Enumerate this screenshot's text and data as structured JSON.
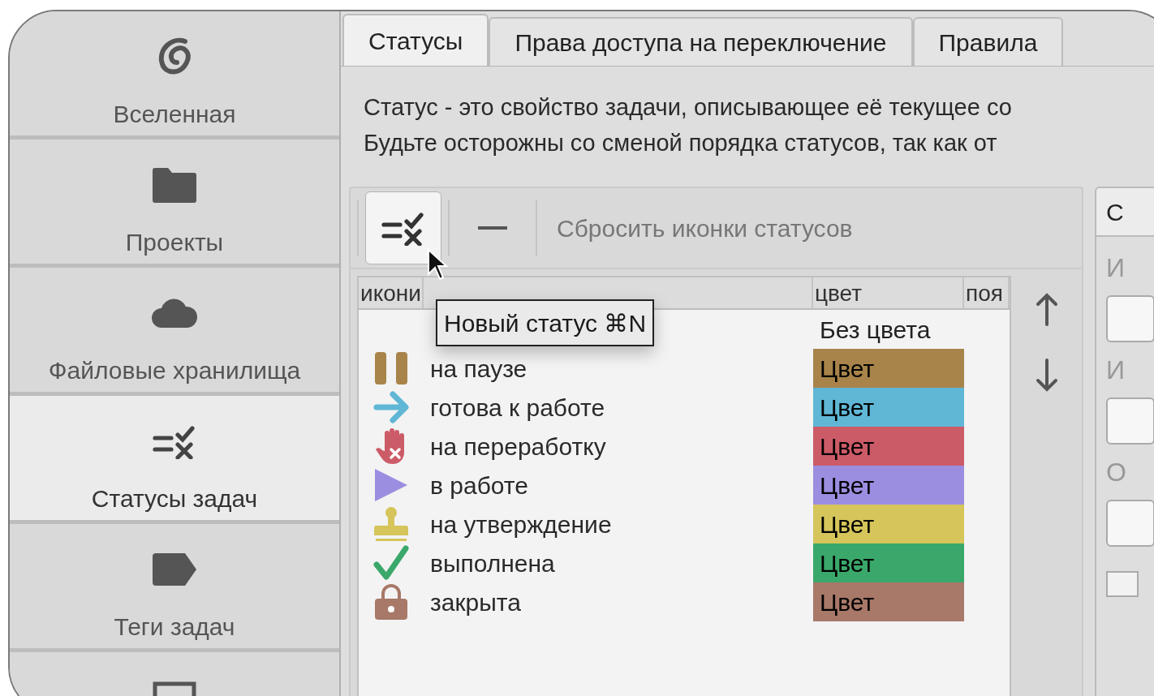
{
  "sidebar": {
    "items": [
      {
        "label": "Вселенная",
        "kind": "swirl",
        "selected": false
      },
      {
        "label": "Проекты",
        "kind": "folder",
        "selected": false
      },
      {
        "label": "Файловые хранилища",
        "kind": "cloud",
        "selected": false
      },
      {
        "label": "Статусы задач",
        "kind": "status",
        "selected": true
      },
      {
        "label": "Теги задач",
        "kind": "tag",
        "selected": false
      },
      {
        "kind": "frame",
        "selected": false
      }
    ]
  },
  "tabs": [
    {
      "label": "Статусы",
      "selected": true
    },
    {
      "label": "Права доступа на переключение",
      "selected": false
    },
    {
      "label": "Правила",
      "selected": false
    }
  ],
  "description": [
    "Статус - это свойство задачи, описывающее её текущее со",
    "Будьте осторожны со сменой порядка статусов, так как от"
  ],
  "toolbar": {
    "reset_label": "Сбросить иконки статусов"
  },
  "table": {
    "columns": [
      {
        "label": "икони"
      },
      {},
      {
        "label": "цвет"
      },
      {
        "label": "поя"
      }
    ],
    "rows": [
      {
        "kind": "none",
        "color_label": "Без цвета"
      },
      {
        "kind": "pause",
        "name": "на паузе",
        "color": "#a8844a",
        "color_label": "Цвет"
      },
      {
        "kind": "arrow",
        "name": "готова к работе",
        "color": "#5fb7d5",
        "color_label": "Цвет"
      },
      {
        "kind": "hand",
        "name": "на переработку",
        "color": "#cc5b68",
        "color_label": "Цвет"
      },
      {
        "kind": "play",
        "name": "в работе",
        "color": "#9b8ee0",
        "color_label": "Цвет"
      },
      {
        "kind": "stamp",
        "name": "на утверждение",
        "color": "#d5c55a",
        "color_label": "Цвет"
      },
      {
        "kind": "check",
        "name": "выполнена",
        "color": "#3aa86a",
        "color_label": "Цвет"
      },
      {
        "kind": "lock",
        "name": "закрыта",
        "color": "#a87868",
        "color_label": "Цвет"
      }
    ]
  },
  "tooltip": {
    "text": "Новый статус ⌘N"
  },
  "side_panel": {
    "tab": "С",
    "labels": [
      "И",
      "И",
      "О"
    ],
    "checkbox": {
      "checked": false
    }
  }
}
